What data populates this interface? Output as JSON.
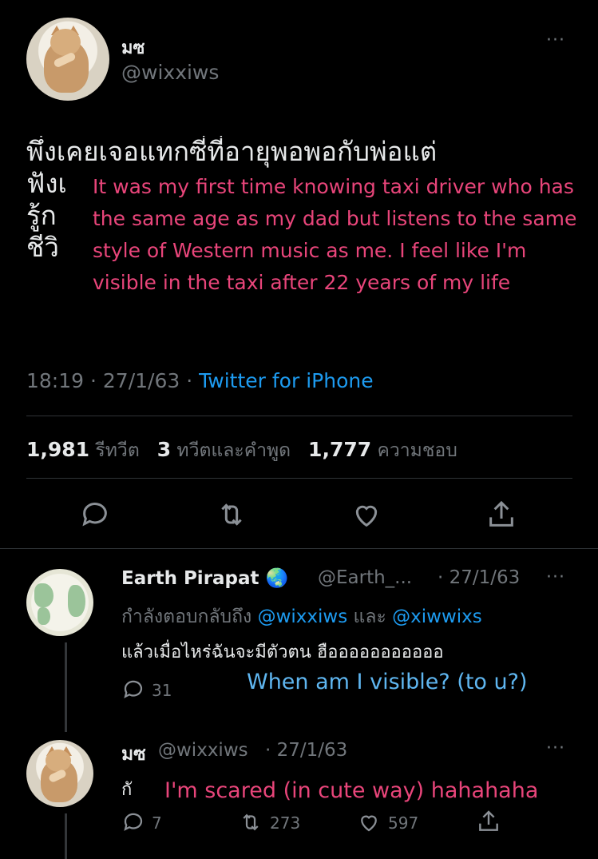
{
  "main_tweet": {
    "display_name": "มซ",
    "handle": "@wixxiws",
    "text_thai": "พึ่งเคยเจอแทกซี่ที่อายุพอพอกับพ่อแต่\nฟังเ\nรู้ก\nชีวิ",
    "translation_overlay": "It was my first time knowing taxi driver who has the same age as my dad but listens to the same style of Western music as me. I feel like I'm visible in the taxi after 22 years of my life",
    "time": "18:19",
    "date": "27/1/63",
    "separator": "·",
    "source": "Twitter for iPhone",
    "stats": {
      "retweets_count": "1,981",
      "retweets_label": "รีทวีต",
      "quotes_count": "3",
      "quotes_label": "ทวีตและคำพูด",
      "likes_count": "1,777",
      "likes_label": "ความชอบ"
    },
    "more_label": "···"
  },
  "reply1": {
    "display_name": "Earth Pirapat",
    "emoji": "🌏",
    "handle": "@Earth_...",
    "date": "· 27/1/63",
    "replying_prefix": "กำลังตอบกลับถึง",
    "replying_to_1": "@wixxiws",
    "replying_and": "และ",
    "replying_to_2": "@xiwwixs",
    "text": "แล้วเมื่อไหร่ฉันจะมีตัวตน ฮือออออออออออ",
    "reply_count": "31",
    "translation_overlay": "When am I visible? (to u?)",
    "more_label": "···"
  },
  "reply2": {
    "display_name": "มซ",
    "handle": "@wixxiws",
    "date": "· 27/1/63",
    "text": "กั",
    "translation_overlay": "I'm scared (in cute way) hahahaha",
    "reply_count": "7",
    "retweet_count": "273",
    "like_count": "597",
    "more_label": "···"
  },
  "colors": {
    "background": "#000000",
    "link": "#1d9bf0",
    "muted": "#71767b",
    "overlay_pink": "#e8457a",
    "overlay_blue": "#5fb6f0"
  }
}
